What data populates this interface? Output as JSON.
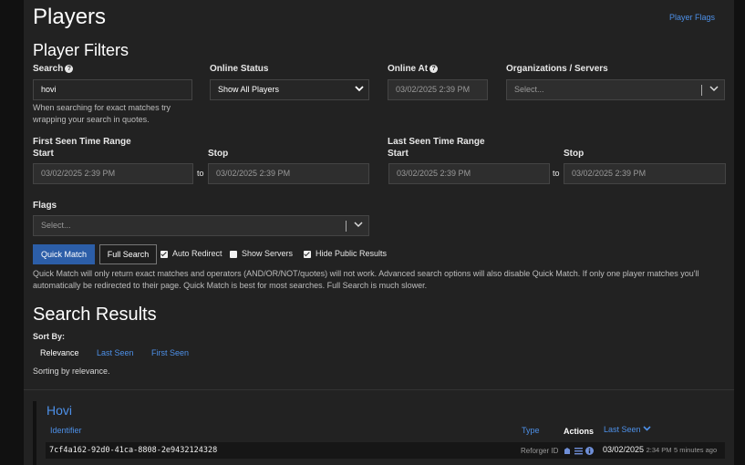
{
  "header": {
    "title": "Players",
    "flags_link": "Player Flags"
  },
  "filters": {
    "title": "Player Filters",
    "search": {
      "label": "Search",
      "value": "hovi",
      "help": "When searching for exact matches try wrapping your search in quotes."
    },
    "online_status": {
      "label": "Online Status",
      "value": "Show All Players"
    },
    "online_at": {
      "label": "Online At",
      "placeholder": "03/02/2025 2:39 PM"
    },
    "orgs": {
      "label": "Organizations / Servers",
      "placeholder": "Select..."
    },
    "first_seen": {
      "label": "First Seen Time Range",
      "start_label": "Start",
      "stop_label": "Stop",
      "start_placeholder": "03/02/2025 2:39 PM",
      "stop_placeholder": "03/02/2025 2:39 PM",
      "to": "to"
    },
    "last_seen": {
      "label": "Last Seen Time Range",
      "start_label": "Start",
      "stop_label": "Stop",
      "start_placeholder": "03/02/2025 2:39 PM",
      "stop_placeholder": "03/02/2025 2:39 PM",
      "to": "to"
    },
    "flags": {
      "label": "Flags",
      "placeholder": "Select..."
    },
    "quick_match": "Quick Match",
    "full_search": "Full Search",
    "auto_redirect": {
      "label": "Auto Redirect",
      "checked": true
    },
    "show_servers": {
      "label": "Show Servers",
      "checked": false
    },
    "hide_public": {
      "label": "Hide Public Results",
      "checked": true
    },
    "note": "Quick Match will only return exact matches and operators (AND/OR/NOT/quotes) will not work. Advanced search options will also disable Quick Match. If only one player matches you'll automatically be redirected to their page. Quick Match is best for most searches. Full Search is much slower."
  },
  "results": {
    "title": "Search Results",
    "sort_label": "Sort By:",
    "sort_options": [
      "Relevance",
      "Last Seen",
      "First Seen"
    ],
    "sorting_note": "Sorting by relevance.",
    "player": {
      "name": "Hovi",
      "col_identifier": "Identifier",
      "col_type": "Type",
      "col_actions": "Actions",
      "col_last_seen": "Last Seen",
      "row": {
        "identifier": "7cf4a162-92d0-41ca-8808-2e9432124328",
        "type": "Reforger ID",
        "date": "03/02/2025",
        "time": "2:34 PM",
        "ago": "5 minutes ago"
      }
    }
  },
  "colors": {
    "accent": "#2c5ea8",
    "link": "#4d90e8",
    "panel": "#222222",
    "background": "#111111"
  }
}
